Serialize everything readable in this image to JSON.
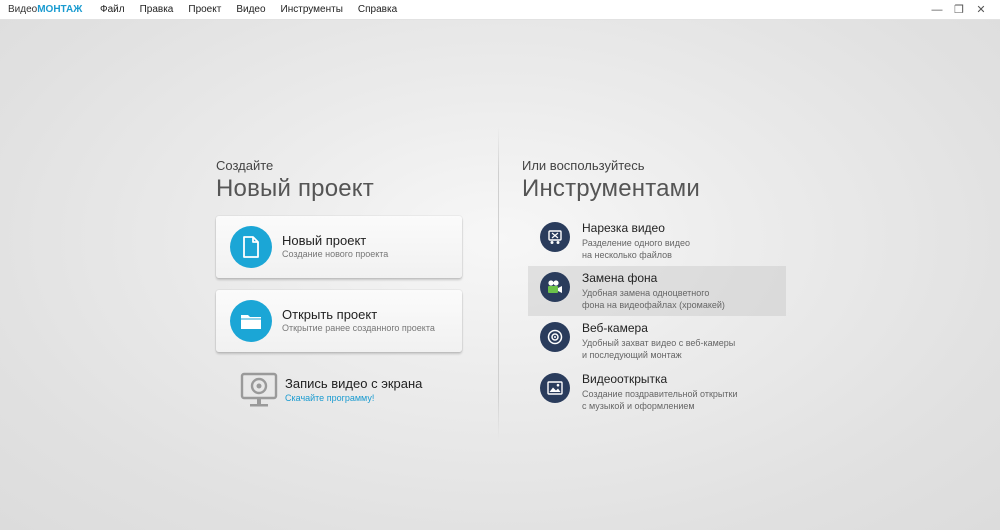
{
  "app": {
    "brand_part1": "Видео",
    "brand_part2": "МОНТАЖ"
  },
  "menu": [
    "Файл",
    "Правка",
    "Проект",
    "Видео",
    "Инструменты",
    "Справка"
  ],
  "window_controls": {
    "minimize": "—",
    "restore": "❐",
    "close": "✕"
  },
  "left": {
    "small_heading": "Создайте",
    "big_heading": "Новый проект",
    "cards": [
      {
        "title": "Новый проект",
        "subtitle": "Создание нового проекта",
        "icon": "document-icon"
      },
      {
        "title": "Открыть проект",
        "subtitle": "Открытие ранее созданного проекта",
        "icon": "folder-icon"
      }
    ],
    "record": {
      "title": "Запись видео с экрана",
      "link": "Скачайте программу!",
      "icon": "monitor-webcam-icon"
    }
  },
  "right": {
    "small_heading": "Или воспользуйтесь",
    "big_heading": "Инструментами",
    "tools": [
      {
        "title": "Нарезка видео",
        "desc1": "Разделение одного видео",
        "desc2": "на несколько файлов",
        "icon": "cut-video-icon"
      },
      {
        "title": "Замена фона",
        "desc1": "Удобная замена одноцветного",
        "desc2": "фона на видеофайлах (хромакей)",
        "icon": "chroma-key-icon",
        "active": true
      },
      {
        "title": "Веб-камера",
        "desc1": "Удобный захват видео с веб-камеры",
        "desc2": "и последующий монтаж",
        "icon": "webcam-icon"
      },
      {
        "title": "Видеооткрытка",
        "desc1": "Создание поздравительной открытки",
        "desc2": "с музыкой и оформлением",
        "icon": "postcard-icon"
      }
    ]
  },
  "colors": {
    "accent": "#1ba6d6",
    "tool_icon_bg": "#2a3c5c",
    "link": "#1a9bd0"
  }
}
